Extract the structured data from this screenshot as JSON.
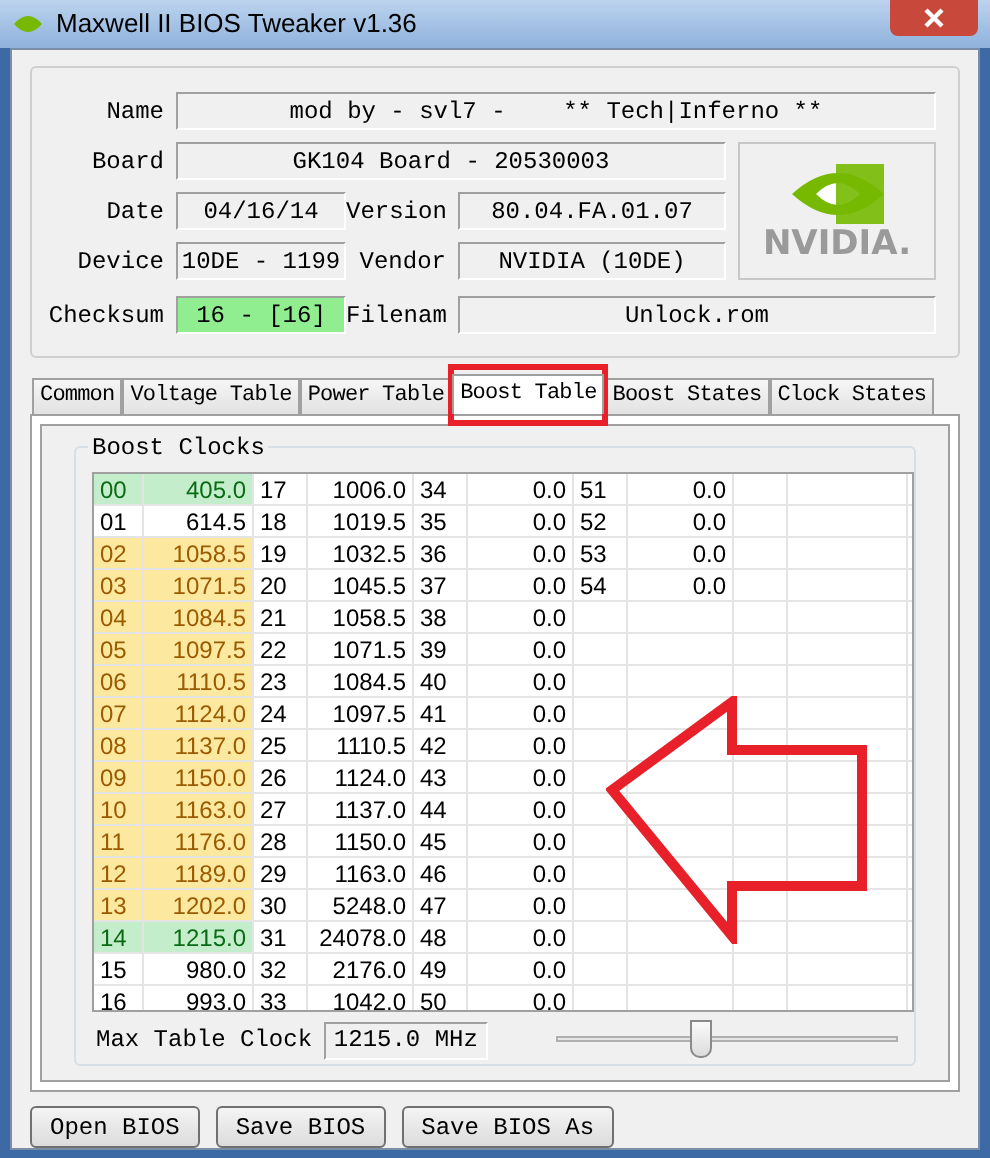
{
  "window": {
    "title": "Maxwell II BIOS Tweaker v1.36"
  },
  "info": {
    "name_label": "Name",
    "name": "mod by - svl7 -    ** Tech|Inferno **",
    "board_label": "Board",
    "board": "GK104 Board - 20530003",
    "date_label": "Date",
    "date": "04/16/14",
    "version_label": "Version",
    "version": "80.04.FA.01.07",
    "device_label": "Device",
    "device": "10DE - 1199",
    "vendor_label": "Vendor",
    "vendor": "NVIDIA (10DE)",
    "checksum_label": "Checksum",
    "checksum": "16 - [16]",
    "checksum_ok": true,
    "filename_label": "Filenam",
    "filename": "Unlock.rom"
  },
  "logo_text": "NVIDIA.",
  "tabs": [
    {
      "label": "Common",
      "selected": false
    },
    {
      "label": "Voltage Table",
      "selected": false
    },
    {
      "label": "Power Table",
      "selected": false
    },
    {
      "label": "Boost Table",
      "selected": true
    },
    {
      "label": "Boost States",
      "selected": false
    },
    {
      "label": "Clock States",
      "selected": false
    }
  ],
  "boost_clocks": {
    "title": "Boost Clocks",
    "rows": [
      {
        "color": "#c4eecb",
        "cells": [
          [
            "00",
            "405.0"
          ],
          [
            "17",
            "1006.0"
          ],
          [
            "34",
            "0.0"
          ],
          [
            "51",
            "0.0"
          ]
        ]
      },
      {
        "cells": [
          [
            "01",
            "614.5"
          ],
          [
            "18",
            "1019.5"
          ],
          [
            "35",
            "0.0"
          ],
          [
            "52",
            "0.0"
          ]
        ]
      },
      {
        "color": "#fde8a0",
        "cells": [
          [
            "02",
            "1058.5"
          ],
          [
            "19",
            "1032.5"
          ],
          [
            "36",
            "0.0"
          ],
          [
            "53",
            "0.0"
          ]
        ]
      },
      {
        "color": "#fde8a0",
        "cells": [
          [
            "03",
            "1071.5"
          ],
          [
            "20",
            "1045.5"
          ],
          [
            "37",
            "0.0"
          ],
          [
            "54",
            "0.0"
          ]
        ]
      },
      {
        "color": "#fde8a0",
        "cells": [
          [
            "04",
            "1084.5"
          ],
          [
            "21",
            "1058.5"
          ],
          [
            "38",
            "0.0"
          ]
        ]
      },
      {
        "color": "#fde8a0",
        "cells": [
          [
            "05",
            "1097.5"
          ],
          [
            "22",
            "1071.5"
          ],
          [
            "39",
            "0.0"
          ]
        ]
      },
      {
        "color": "#fde8a0",
        "cells": [
          [
            "06",
            "1110.5"
          ],
          [
            "23",
            "1084.5"
          ],
          [
            "40",
            "0.0"
          ]
        ]
      },
      {
        "color": "#fde8a0",
        "cells": [
          [
            "07",
            "1124.0"
          ],
          [
            "24",
            "1097.5"
          ],
          [
            "41",
            "0.0"
          ]
        ]
      },
      {
        "color": "#fde8a0",
        "cells": [
          [
            "08",
            "1137.0"
          ],
          [
            "25",
            "1110.5"
          ],
          [
            "42",
            "0.0"
          ]
        ]
      },
      {
        "color": "#fde8a0",
        "cells": [
          [
            "09",
            "1150.0"
          ],
          [
            "26",
            "1124.0"
          ],
          [
            "43",
            "0.0"
          ]
        ]
      },
      {
        "color": "#fde8a0",
        "cells": [
          [
            "10",
            "1163.0"
          ],
          [
            "27",
            "1137.0"
          ],
          [
            "44",
            "0.0"
          ]
        ]
      },
      {
        "color": "#fde8a0",
        "cells": [
          [
            "11",
            "1176.0"
          ],
          [
            "28",
            "1150.0"
          ],
          [
            "45",
            "0.0"
          ]
        ]
      },
      {
        "color": "#fde8a0",
        "cells": [
          [
            "12",
            "1189.0"
          ],
          [
            "29",
            "1163.0"
          ],
          [
            "46",
            "0.0"
          ]
        ]
      },
      {
        "color": "#fde8a0",
        "cells": [
          [
            "13",
            "1202.0"
          ],
          [
            "30",
            "5248.0"
          ],
          [
            "47",
            "0.0"
          ]
        ]
      },
      {
        "color": "#c4eecb",
        "cells": [
          [
            "14",
            "1215.0"
          ],
          [
            "31",
            "24078.0"
          ],
          [
            "48",
            "0.0"
          ]
        ]
      },
      {
        "cells": [
          [
            "15",
            "980.0"
          ],
          [
            "32",
            "2176.0"
          ],
          [
            "49",
            "0.0"
          ]
        ]
      },
      {
        "cells": [
          [
            "16",
            "993.0"
          ],
          [
            "33",
            "1042.0"
          ],
          [
            "50",
            "0.0"
          ]
        ]
      }
    ],
    "max_label": "Max Table Clock",
    "max_value": "1215.0 MHz",
    "slider": {
      "level": 0.42
    }
  },
  "buttons": [
    "Open BIOS",
    "Save BIOS",
    "Save BIOS As"
  ]
}
